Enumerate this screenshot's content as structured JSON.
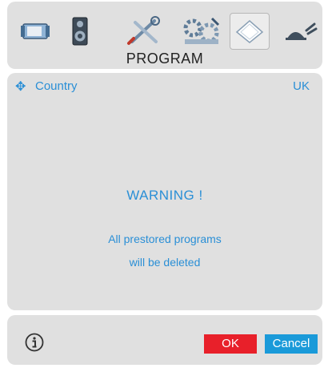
{
  "header": {
    "title": "PROGRAM",
    "tabs": [
      {
        "name": "picture",
        "icon": "picture-icon"
      },
      {
        "name": "sound",
        "icon": "speaker-icon"
      },
      {
        "name": "tools",
        "icon": "tools-icon"
      },
      {
        "name": "install",
        "icon": "install-icon"
      },
      {
        "name": "program",
        "icon": "program-icon",
        "selected": true
      },
      {
        "name": "satellite",
        "icon": "satellite-dish-icon"
      }
    ]
  },
  "main": {
    "setting_label": "Country",
    "setting_value": "UK",
    "warning_title": "WARNING !",
    "warning_line1": "All prestored programs",
    "warning_line2": "will be deleted"
  },
  "footer": {
    "ok_label": "OK",
    "cancel_label": "Cancel"
  },
  "colors": {
    "accent_text": "#2a8fd6",
    "ok": "#e8202a",
    "cancel": "#1a9ad9",
    "panel": "#e0e0e0"
  }
}
